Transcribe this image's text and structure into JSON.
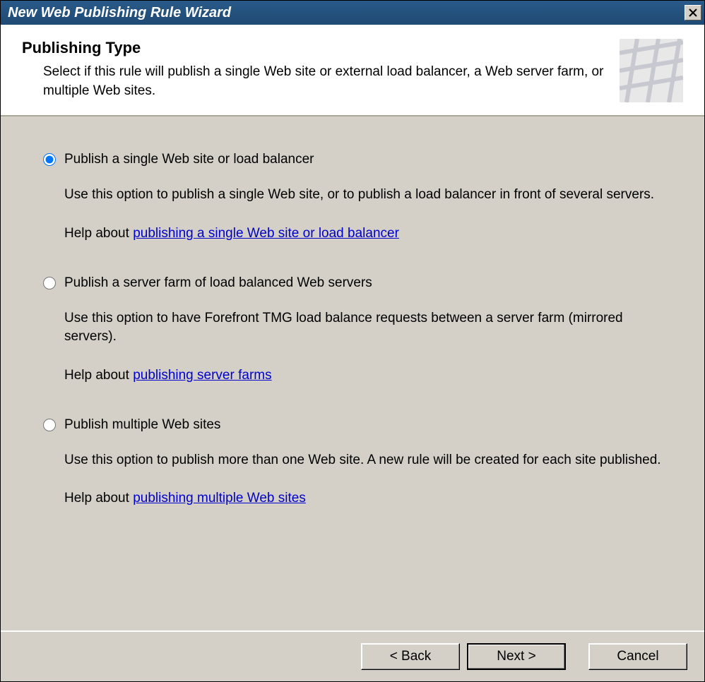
{
  "window": {
    "title": "New Web Publishing Rule Wizard"
  },
  "header": {
    "title": "Publishing Type",
    "subtitle": "Select if this rule will publish a single Web site or external load balancer, a Web server farm, or multiple Web sites."
  },
  "options": [
    {
      "label": "Publish a single Web site or load balancer",
      "description": "Use this option to publish a single Web site, or to publish a load balancer in front of several servers.",
      "help_prefix": "Help about ",
      "help_link": "publishing a single Web site or load balancer",
      "selected": true
    },
    {
      "label": "Publish a server farm of load balanced Web servers",
      "description": "Use this option to have Forefront TMG load balance requests between a server farm (mirrored servers).",
      "help_prefix": "Help about ",
      "help_link": "publishing server farms",
      "selected": false
    },
    {
      "label": "Publish multiple Web sites",
      "description": "Use this option to publish more than one Web site. A new rule will be created for each site published.",
      "help_prefix": "Help about ",
      "help_link": "publishing multiple Web sites",
      "selected": false
    }
  ],
  "footer": {
    "back": "< Back",
    "next": "Next >",
    "cancel": "Cancel"
  }
}
